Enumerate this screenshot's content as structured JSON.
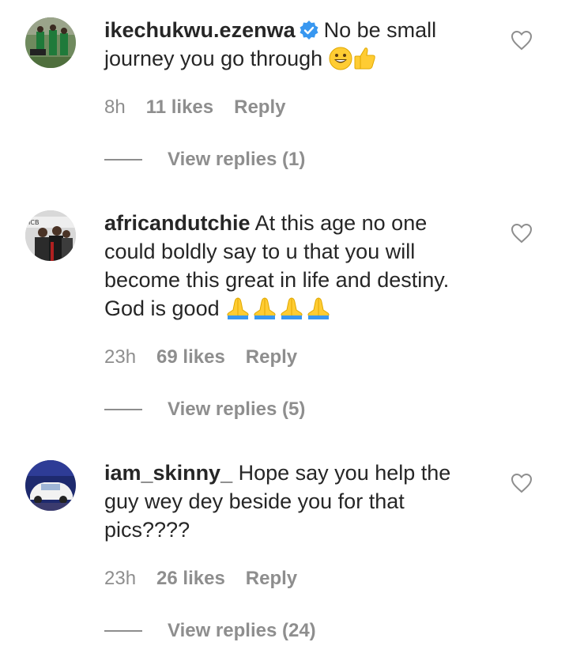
{
  "comments": [
    {
      "username": "ikechukwu.ezenwa",
      "verified": true,
      "text": "No be small journey you go through",
      "emoji": [
        "smiley",
        "thumbs-up"
      ],
      "time": "8h",
      "likes": "11 likes",
      "reply": "Reply",
      "view_replies": "View replies (1)"
    },
    {
      "username": "africandutchie",
      "verified": false,
      "text": "At this age no one could boldly say to u that you will become this great in life and destiny. God is good",
      "emoji": [
        "folded-hands",
        "folded-hands",
        "folded-hands",
        "folded-hands"
      ],
      "time": "23h",
      "likes": "69 likes",
      "reply": "Reply",
      "view_replies": "View replies (5)"
    },
    {
      "username": "iam_skinny_",
      "verified": false,
      "text": "Hope say you help the guy wey dey beside you for that pics????",
      "emoji": [],
      "time": "23h",
      "likes": "26 likes",
      "reply": "Reply",
      "view_replies": "View replies (24)"
    }
  ],
  "colors": {
    "text": "#262626",
    "muted": "#8e8e8e",
    "verified": "#3897f0"
  }
}
